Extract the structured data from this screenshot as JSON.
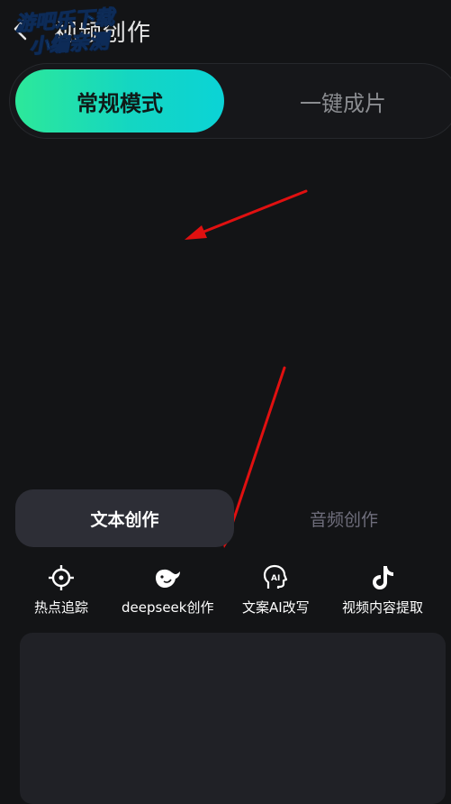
{
  "header": {
    "title": "视频创作",
    "back_icon": "chevron-left-icon"
  },
  "watermark": {
    "line1": "游吧乐下载",
    "line2": "小编亲测"
  },
  "mode_tabs": [
    {
      "label": "常规模式",
      "active": true
    },
    {
      "label": "一键成片",
      "active": false
    }
  ],
  "sub_tabs": [
    {
      "label": "文本创作",
      "active": true
    },
    {
      "label": "音频创作",
      "active": false
    }
  ],
  "tools": [
    {
      "label": "热点追踪",
      "icon": "crosshair-icon"
    },
    {
      "label": "deepseek创作",
      "icon": "whale-icon"
    },
    {
      "label": "文案AI改写",
      "icon": "ai-head-icon"
    },
    {
      "label": "视频内容提取",
      "icon": "tiktok-icon"
    }
  ],
  "annotation": {
    "arrow_color": "#e01010"
  },
  "colors": {
    "background": "#131416",
    "accent_gradient_start": "#2de89a",
    "accent_gradient_end": "#0bd3d6"
  }
}
